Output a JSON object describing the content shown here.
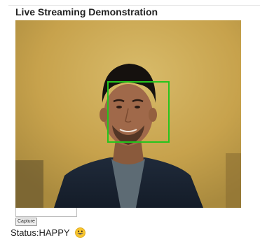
{
  "header": {
    "title": "Live Streaming Demonstration"
  },
  "video": {
    "face_box_color": "#26c41c",
    "wall_color": "#c9a650"
  },
  "controls": {
    "text_value": "",
    "capture_label": "Capture"
  },
  "status": {
    "label": "Status:",
    "value": "HAPPY",
    "emoji_icon": "grinning-face-icon"
  }
}
